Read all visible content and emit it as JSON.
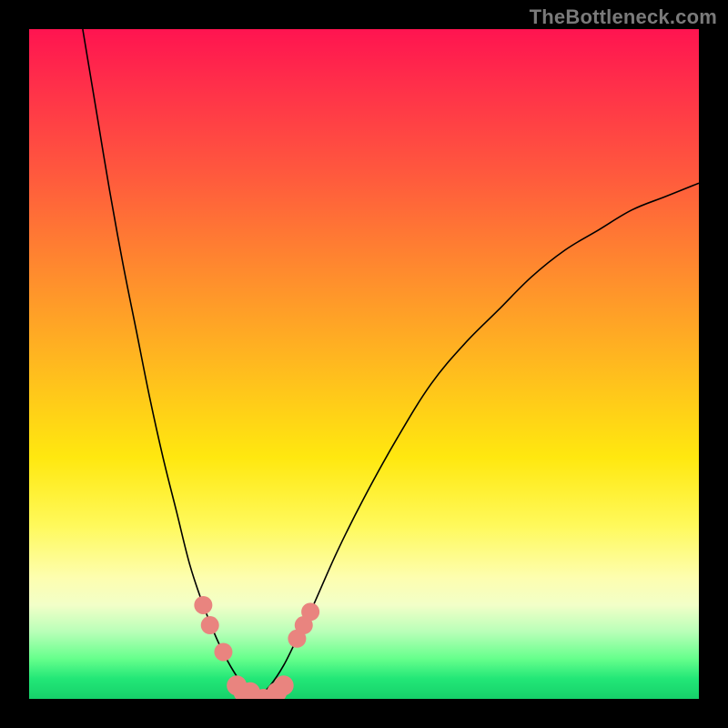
{
  "attribution": "TheBottleneck.com",
  "colors": {
    "frame_background_top": "#ff1450",
    "frame_background_bottom": "#16d06a",
    "curve_stroke": "#000000",
    "marker_fill": "#e9847f",
    "page_background": "#000000",
    "attribution_text": "#7a7a7a"
  },
  "chart_data": {
    "type": "line",
    "title": "",
    "xlabel": "",
    "ylabel": "",
    "xlim": [
      0,
      100
    ],
    "ylim": [
      0,
      100
    ],
    "grid": false,
    "legend": false,
    "series": [
      {
        "name": "left-curve",
        "x": [
          8,
          10,
          12,
          14,
          16,
          18,
          20,
          22,
          24,
          26,
          28,
          30,
          32,
          34
        ],
        "y": [
          100,
          88,
          76,
          65,
          55,
          45,
          36,
          28,
          20,
          14,
          9,
          5,
          2,
          0
        ]
      },
      {
        "name": "right-curve",
        "x": [
          34,
          36,
          38,
          40,
          42,
          46,
          50,
          55,
          60,
          65,
          70,
          75,
          80,
          85,
          90,
          95,
          100
        ],
        "y": [
          0,
          2,
          5,
          9,
          13,
          22,
          30,
          39,
          47,
          53,
          58,
          63,
          67,
          70,
          73,
          75,
          77
        ]
      }
    ],
    "markers": [
      {
        "series": "left-curve",
        "x": 26,
        "y": 14
      },
      {
        "series": "left-curve",
        "x": 27,
        "y": 11
      },
      {
        "series": "left-curve",
        "x": 29,
        "y": 7
      },
      {
        "series": "valley",
        "x": 31,
        "y": 2
      },
      {
        "series": "valley",
        "x": 32,
        "y": 1
      },
      {
        "series": "valley",
        "x": 33,
        "y": 1
      },
      {
        "series": "valley",
        "x": 34,
        "y": 0
      },
      {
        "series": "valley",
        "x": 35,
        "y": 0
      },
      {
        "series": "valley",
        "x": 36,
        "y": 0
      },
      {
        "series": "valley",
        "x": 37,
        "y": 1
      },
      {
        "series": "valley",
        "x": 38,
        "y": 2
      },
      {
        "series": "right-curve",
        "x": 40,
        "y": 9
      },
      {
        "series": "right-curve",
        "x": 41,
        "y": 11
      },
      {
        "series": "right-curve",
        "x": 42,
        "y": 13
      }
    ]
  }
}
